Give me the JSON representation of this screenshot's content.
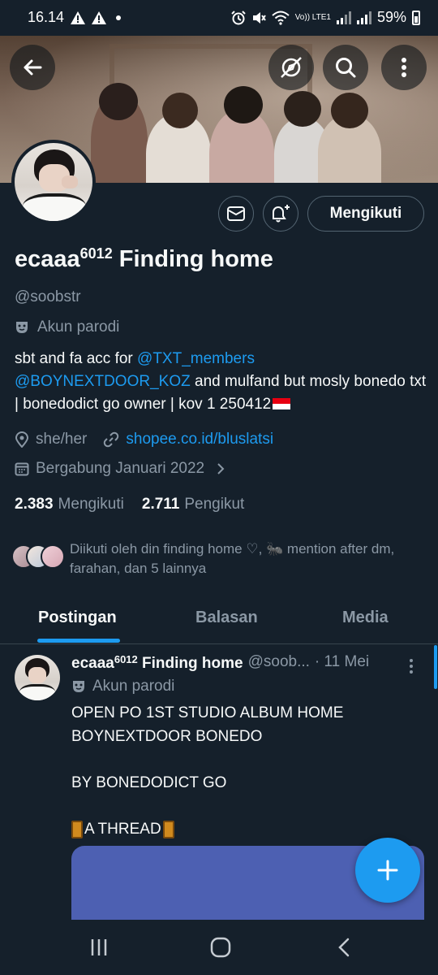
{
  "status_bar": {
    "time": "16.14",
    "battery": "59%",
    "network": "Vo)) LTE1"
  },
  "header": {
    "back_icon": "arrow-left-icon",
    "explore_icon": "explore-off-icon",
    "search_icon": "search-icon",
    "more_icon": "more-vertical-icon"
  },
  "profile": {
    "display_name": "ecaaa",
    "name_superscript": "6012",
    "name_suffix": " Finding home",
    "handle": "@soobstr",
    "parody_label": "Akun parodi",
    "follow_button": "Mengikuti",
    "bio": {
      "part1": "sbt and fa acc for ",
      "mention1": "@TXT_members",
      "mention2": "@BOYNEXTDOOR_KOZ",
      "part2": " and mulfand but mosly bonedo txt | bonedodict go owner | kov 1 250412"
    },
    "pronouns": "she/her",
    "website": "shopee.co.id/bluslatsi",
    "joined": "Bergabung Januari 2022",
    "following_count": "2.383",
    "following_label": "Mengikuti",
    "followers_count": "2.711",
    "followers_label": "Pengikut",
    "followed_by": "Diikuti oleh din finding home ♡, 🐜 mention after dm, farahan, dan 5 lainnya"
  },
  "tabs": [
    {
      "label": "Postingan",
      "active": true
    },
    {
      "label": "Balasan",
      "active": false
    },
    {
      "label": "Media",
      "active": false
    }
  ],
  "post": {
    "author": "ecaaa",
    "author_sup": "6012",
    "author_suffix": " Finding home",
    "handle": "@soob...",
    "date": "· 11 Mei",
    "parody_label": "Akun parodi",
    "lines": [
      "OPEN PO 1ST STUDIO ALBUM HOME",
      "BOYNEXTDOOR BONEDO",
      "",
      "BY BONEDODICT GO",
      "",
      "A THREAD"
    ]
  },
  "colors": {
    "background": "#15202b",
    "accent": "#1d9bf0",
    "secondary_text": "#8b98a5",
    "media_placeholder": "#4d60b2"
  }
}
